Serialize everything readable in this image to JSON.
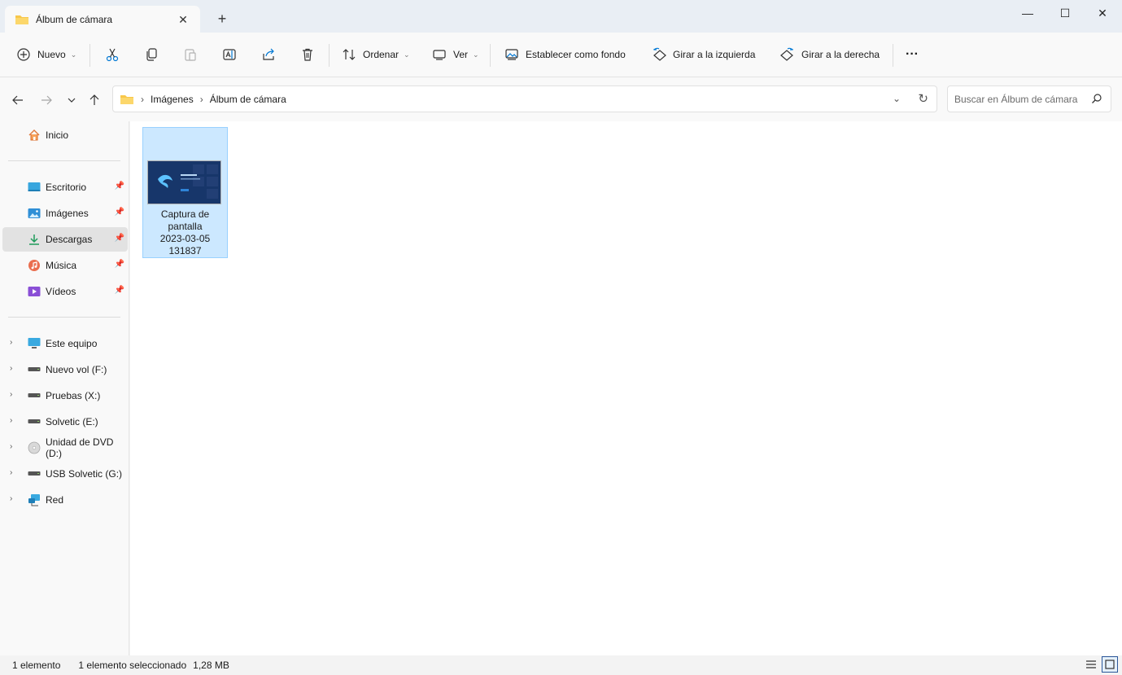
{
  "window": {
    "tab_title": "Álbum de cámara",
    "new_tab": "+",
    "tab_close": "✕",
    "minimize": "—",
    "maximize": "☐",
    "close": "✕"
  },
  "toolbar": {
    "new_label": "Nuevo",
    "sort_label": "Ordenar",
    "view_label": "Ver",
    "set_background_label": "Establecer como fondo",
    "rotate_left_label": "Girar a la izquierda",
    "rotate_right_label": "Girar a la derecha",
    "more_label": "···"
  },
  "address": {
    "crumbs": [
      "Imágenes",
      "Álbum de cámara"
    ],
    "search_placeholder": "Buscar en Álbum de cámara"
  },
  "sidebar": {
    "home": "Inicio",
    "quick_access": [
      {
        "label": "Escritorio",
        "icon": "desktop-icon"
      },
      {
        "label": "Imágenes",
        "icon": "pictures-icon"
      },
      {
        "label": "Descargas",
        "icon": "downloads-icon",
        "selected": true
      },
      {
        "label": "Música",
        "icon": "music-icon"
      },
      {
        "label": "Vídeos",
        "icon": "videos-icon"
      }
    ],
    "drives": [
      {
        "label": "Este equipo",
        "icon": "computer-icon"
      },
      {
        "label": "Nuevo vol (F:)",
        "icon": "drive-icon"
      },
      {
        "label": "Pruebas (X:)",
        "icon": "drive-icon"
      },
      {
        "label": "Solvetic (E:)",
        "icon": "drive-icon"
      },
      {
        "label": "Unidad de DVD (D:)",
        "icon": "dvd-icon"
      },
      {
        "label": "USB Solvetic (G:)",
        "icon": "drive-icon"
      },
      {
        "label": "Red",
        "icon": "network-icon"
      }
    ]
  },
  "files": [
    {
      "name_line1": "Captura de",
      "name_line2": "pantalla",
      "name_line3": "2023-03-05",
      "name_line4": "131837",
      "selected": true
    }
  ],
  "status": {
    "count": "1 elemento",
    "selection": "1 elemento seleccionado",
    "size": "1,28 MB"
  },
  "colors": {
    "accent": "#0078d4",
    "selection_fill": "#cce8ff",
    "selection_border": "#99d1ff",
    "folder_yellow": "#f8c74a"
  }
}
